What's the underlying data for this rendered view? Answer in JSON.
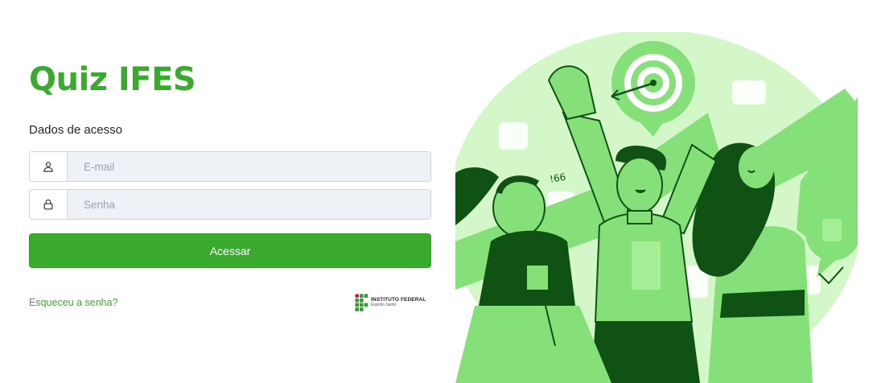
{
  "app": {
    "title": "Quiz IFES"
  },
  "login": {
    "section_label": "Dados de acesso",
    "email": {
      "placeholder": "E-mail",
      "value": ""
    },
    "password": {
      "placeholder": "Senha",
      "value": ""
    },
    "submit_label": "Acessar",
    "forgot_label": "Esqueceu a senha?"
  },
  "logo": {
    "name": "INSTITUTO FEDERAL",
    "campus": "Espírito Santo"
  },
  "illustration": {
    "icon": "people-celebrating-target-illustration",
    "handwriting": "!66"
  },
  "colors": {
    "brand": "#3aaa2e",
    "input_bg": "#eef1f5",
    "illustration_light": "#d3f7c8",
    "illustration_mid": "#86e07a",
    "illustration_dark": "#0f5214"
  }
}
